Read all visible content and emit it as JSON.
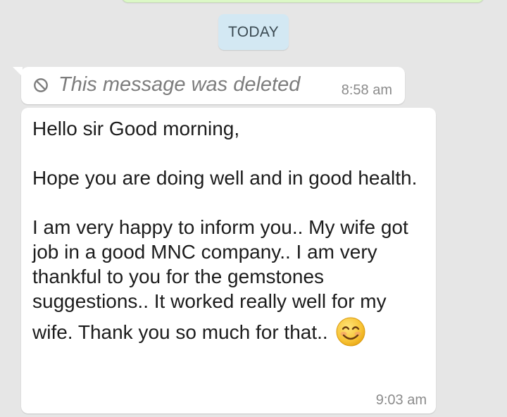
{
  "chat": {
    "date_separator": "TODAY",
    "deleted_message": {
      "text": "This message was deleted",
      "time": "8:58 am",
      "icon": "blocked-circle-icon"
    },
    "message": {
      "paragraph1": "Hello sir Good morning,",
      "paragraph2": "Hope you are doing well and in good health.",
      "paragraph3": "I am very happy to inform you.. My wife got job in a good MNC company.. I am very thankful to you for the gemstones suggestions.. It worked really well for my",
      "last_line": "wife. Thank you so much for that..",
      "emoji": "smiling-face-emoji",
      "time": "9:03 am"
    }
  },
  "colors": {
    "background": "#e6e6e6",
    "incoming_bubble": "#ffffff",
    "outgoing_bubble": "#dcf8c6",
    "date_chip": "#d3e8f3"
  }
}
